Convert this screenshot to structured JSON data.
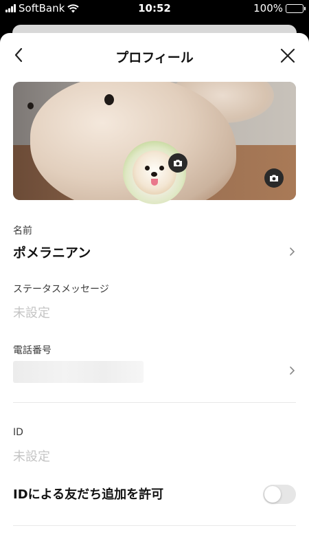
{
  "status_bar": {
    "carrier": "SoftBank",
    "time": "10:52",
    "battery": "100%"
  },
  "header": {
    "title": "プロフィール"
  },
  "profile": {
    "name_label": "名前",
    "name_value": "ポメラニアン",
    "status_label": "ステータスメッセージ",
    "status_placeholder": "未設定",
    "phone_label": "電話番号",
    "id_label": "ID",
    "id_placeholder": "未設定",
    "allow_add_by_id_label": "IDによる友だち追加を許可",
    "allow_add_by_id_enabled": false
  },
  "icons": {
    "back": "chevron-left-icon",
    "close": "close-icon",
    "camera": "camera-icon",
    "chevron": "chevron-right-icon"
  }
}
